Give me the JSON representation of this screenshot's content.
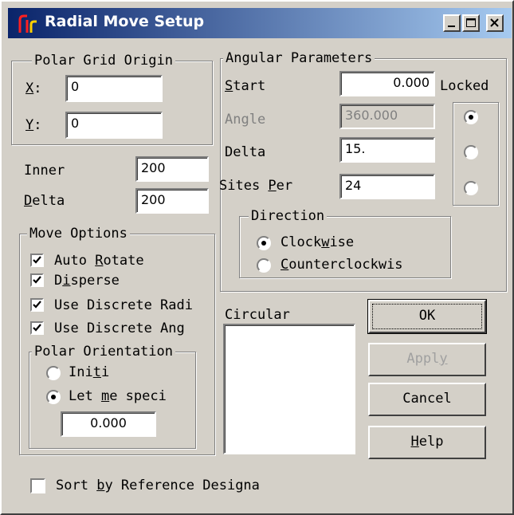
{
  "window": {
    "title": "Radial Move Setup",
    "buttons": [
      "minimize",
      "maximize",
      "close"
    ]
  },
  "polar_grid_origin": {
    "legend": "Polar Grid Origin",
    "x": {
      "key": "X",
      "rest": ":",
      "value": "0"
    },
    "y": {
      "key": "Y",
      "rest": ":",
      "value": "0"
    }
  },
  "inner": {
    "label": "Inner",
    "value": "200"
  },
  "delta": {
    "key": "D",
    "rest": "elta",
    "value": "200"
  },
  "move_options": {
    "legend": "Move Options",
    "auto_rotate": {
      "pre": "Auto ",
      "key": "R",
      "post": "otate",
      "checked": true
    },
    "disperse": {
      "pre": "D",
      "key": "i",
      "post": "sperse",
      "checked": true
    },
    "use_discrete_radi": {
      "label": "Use Discrete Radi",
      "checked": true
    },
    "use_discrete_ang": {
      "label": "Use Discrete Ang",
      "checked": true
    },
    "polar_orientation": {
      "legend": "Polar Orientation",
      "initial": {
        "pre": "Ini",
        "key": "t",
        "post": "i",
        "selected": false
      },
      "let_me_specify": {
        "pre": "Let ",
        "key": "m",
        "post": "e speci",
        "selected": true
      },
      "value": "0.000"
    }
  },
  "angular_parameters": {
    "legend": "Angular Parameters",
    "locked_label": "Locked",
    "start": {
      "key": "S",
      "rest": "tart",
      "value": "0.000",
      "locked": true
    },
    "angle": {
      "label": "Angle",
      "value": "360.000",
      "locked": false,
      "disabled": true
    },
    "delta": {
      "label": "Delta",
      "value": "15.",
      "locked": false
    },
    "sites_per": {
      "pre": "Sites ",
      "key": "P",
      "post": "er",
      "value": "24",
      "locked": false
    },
    "direction": {
      "legend": "Direction",
      "clockwise": {
        "pre": "Clock",
        "key": "w",
        "post": "ise",
        "selected": true
      },
      "counterclockwise": {
        "key": "C",
        "post": "ounterclockwis",
        "selected": false
      }
    }
  },
  "circular": {
    "label": "Circular",
    "items": []
  },
  "buttons": {
    "ok": "OK",
    "apply": {
      "pre": "Appl",
      "key": "y",
      "disabled": true
    },
    "cancel": "Cancel",
    "help": {
      "key": "H",
      "post": "elp"
    }
  },
  "sort_by_reference": {
    "pre": "Sort ",
    "key": "b",
    "post": "y Reference Designa",
    "checked": false
  },
  "colors": {
    "title_gradient_start": "#0a246a",
    "title_gradient_end": "#a6caf0",
    "face": "#d4d0c8",
    "disabled_text": "#808080"
  }
}
